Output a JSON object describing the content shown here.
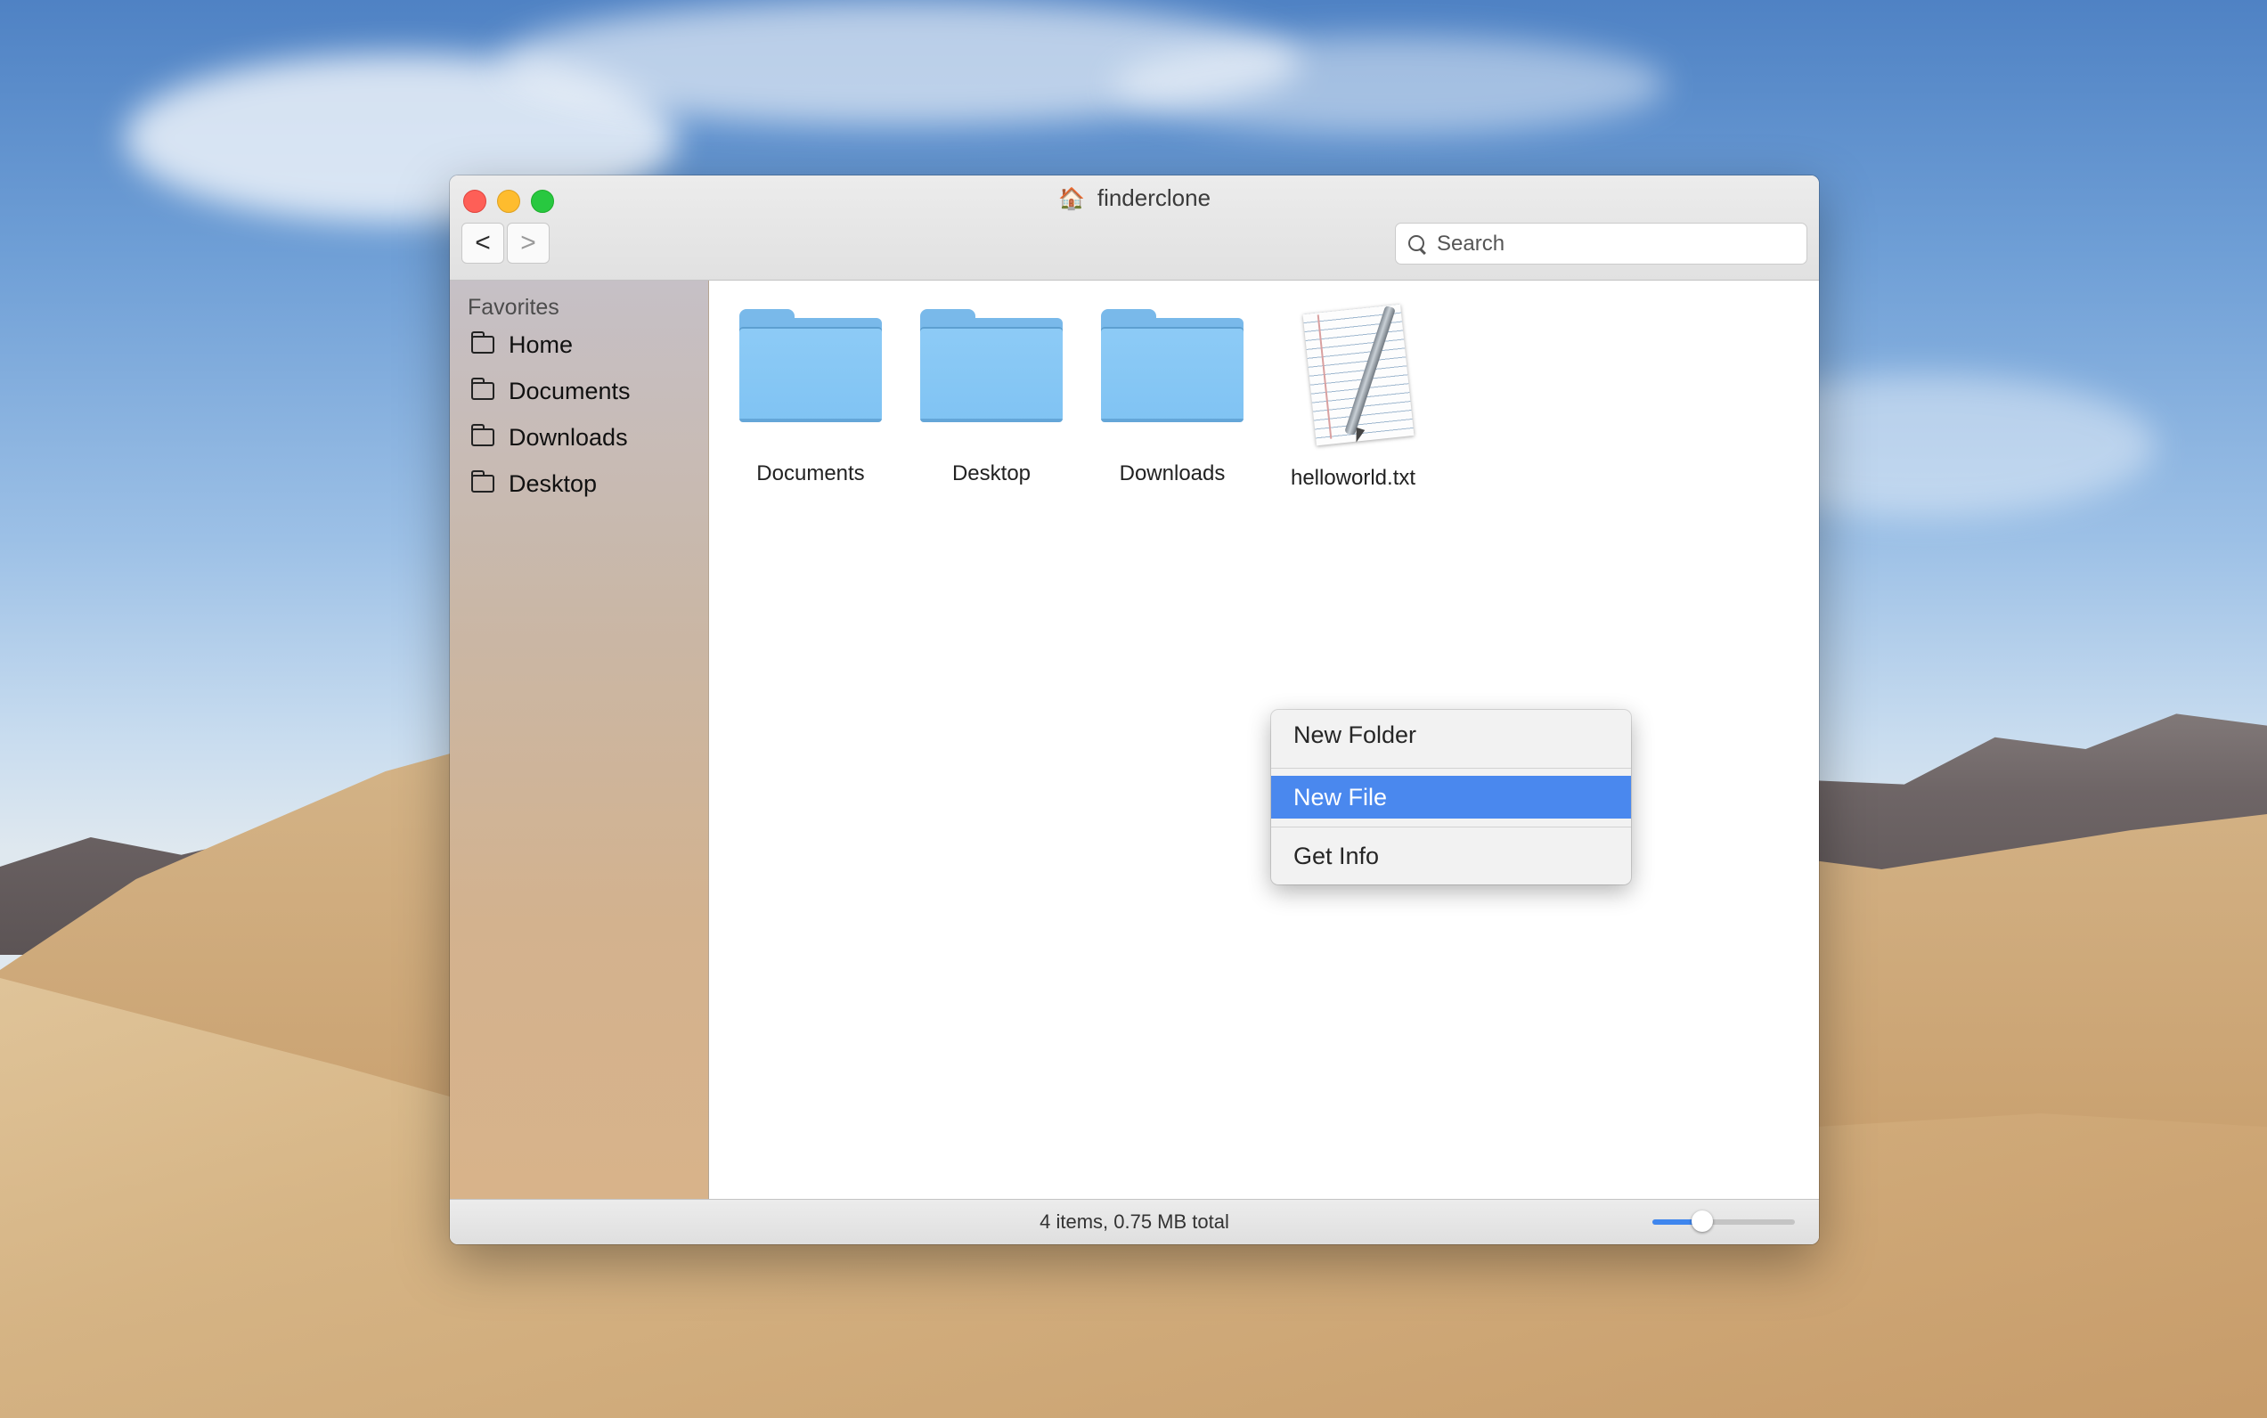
{
  "window": {
    "title": "finderclone",
    "title_icon": "house-icon",
    "back_label": "<",
    "forward_label": ">"
  },
  "search": {
    "placeholder": "Search",
    "value": ""
  },
  "sidebar": {
    "heading": "Favorites",
    "items": [
      {
        "label": "Home",
        "icon": "folder-icon"
      },
      {
        "label": "Documents",
        "icon": "folder-icon"
      },
      {
        "label": "Downloads",
        "icon": "folder-icon"
      },
      {
        "label": "Desktop",
        "icon": "folder-icon"
      }
    ]
  },
  "files": [
    {
      "name": "Documents",
      "kind": "folder"
    },
    {
      "name": "Desktop",
      "kind": "folder"
    },
    {
      "name": "Downloads",
      "kind": "folder"
    },
    {
      "name": "helloworld.txt",
      "kind": "text-document"
    }
  ],
  "context_menu": {
    "items": [
      {
        "label": "New Folder",
        "highlighted": false
      },
      {
        "label": "New File",
        "highlighted": true
      },
      {
        "label": "Get Info",
        "highlighted": false
      }
    ]
  },
  "status": {
    "summary": "4 items, 0.75 MB total",
    "icon_size_fraction": 0.35
  },
  "colors": {
    "accent": "#4a88ee",
    "close": "#fe5f57",
    "minimize": "#febc2e",
    "maximize": "#28c840",
    "folder": "#80c3f3"
  }
}
